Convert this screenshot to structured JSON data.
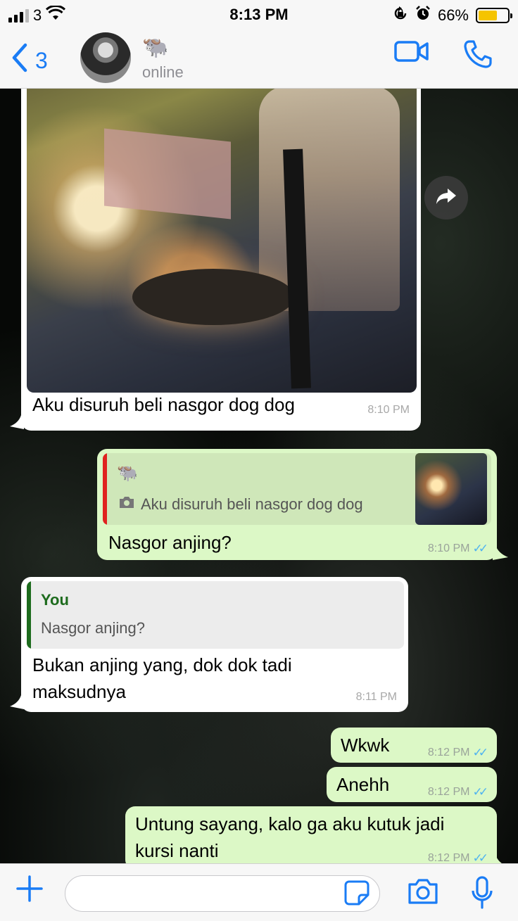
{
  "status_bar": {
    "carrier": "3",
    "time": "8:13 PM",
    "battery": "66%",
    "battery_level": 0.66,
    "icons": [
      "signal-icon",
      "wifi-icon",
      "orientation-lock-icon",
      "alarm-icon",
      "battery-icon"
    ]
  },
  "header": {
    "back_count": "3",
    "contact_name": "🐃",
    "contact_status": "online",
    "icons": [
      "back-chevron-icon",
      "avatar",
      "video-call-icon",
      "phone-call-icon"
    ]
  },
  "messages": [
    {
      "direction": "incoming",
      "type": "image",
      "caption": "Aku disuruh beli nasgor dog dog",
      "time": "8:10 PM"
    },
    {
      "direction": "outgoing",
      "reply_to": {
        "author": "🐃",
        "text": "Aku disuruh beli nasgor dog dog",
        "has_photo": true
      },
      "text": "Nasgor anjing?",
      "time": "8:10 PM",
      "read": true
    },
    {
      "direction": "incoming",
      "reply_to": {
        "author": "You",
        "text": "Nasgor anjing?"
      },
      "text_line1": "Bukan anjing yang, dok dok tadi",
      "text_line2": "maksudnya",
      "time": "8:11 PM"
    },
    {
      "direction": "outgoing",
      "text": "Wkwk",
      "time": "8:12 PM",
      "read": true
    },
    {
      "direction": "outgoing",
      "text": "Anehh",
      "time": "8:12 PM",
      "read": true
    },
    {
      "direction": "outgoing",
      "text_line1": "Untung sayang, kalo ga aku kutuk jadi",
      "text_line2": "kursi nanti",
      "time": "8:12 PM",
      "read": true
    }
  ],
  "input_bar": {
    "value": "",
    "placeholder": "",
    "icons": [
      "plus-icon",
      "sticker-icon",
      "camera-icon",
      "microphone-icon"
    ]
  },
  "colors": {
    "accent": "#1a7cf5",
    "outgoing_bubble": "#dcf8c6",
    "incoming_bubble": "#ffffff",
    "read_ticks": "#4fb3f0",
    "quote_bar_red": "#e0221f",
    "quote_bar_green": "#1d6b1d"
  }
}
